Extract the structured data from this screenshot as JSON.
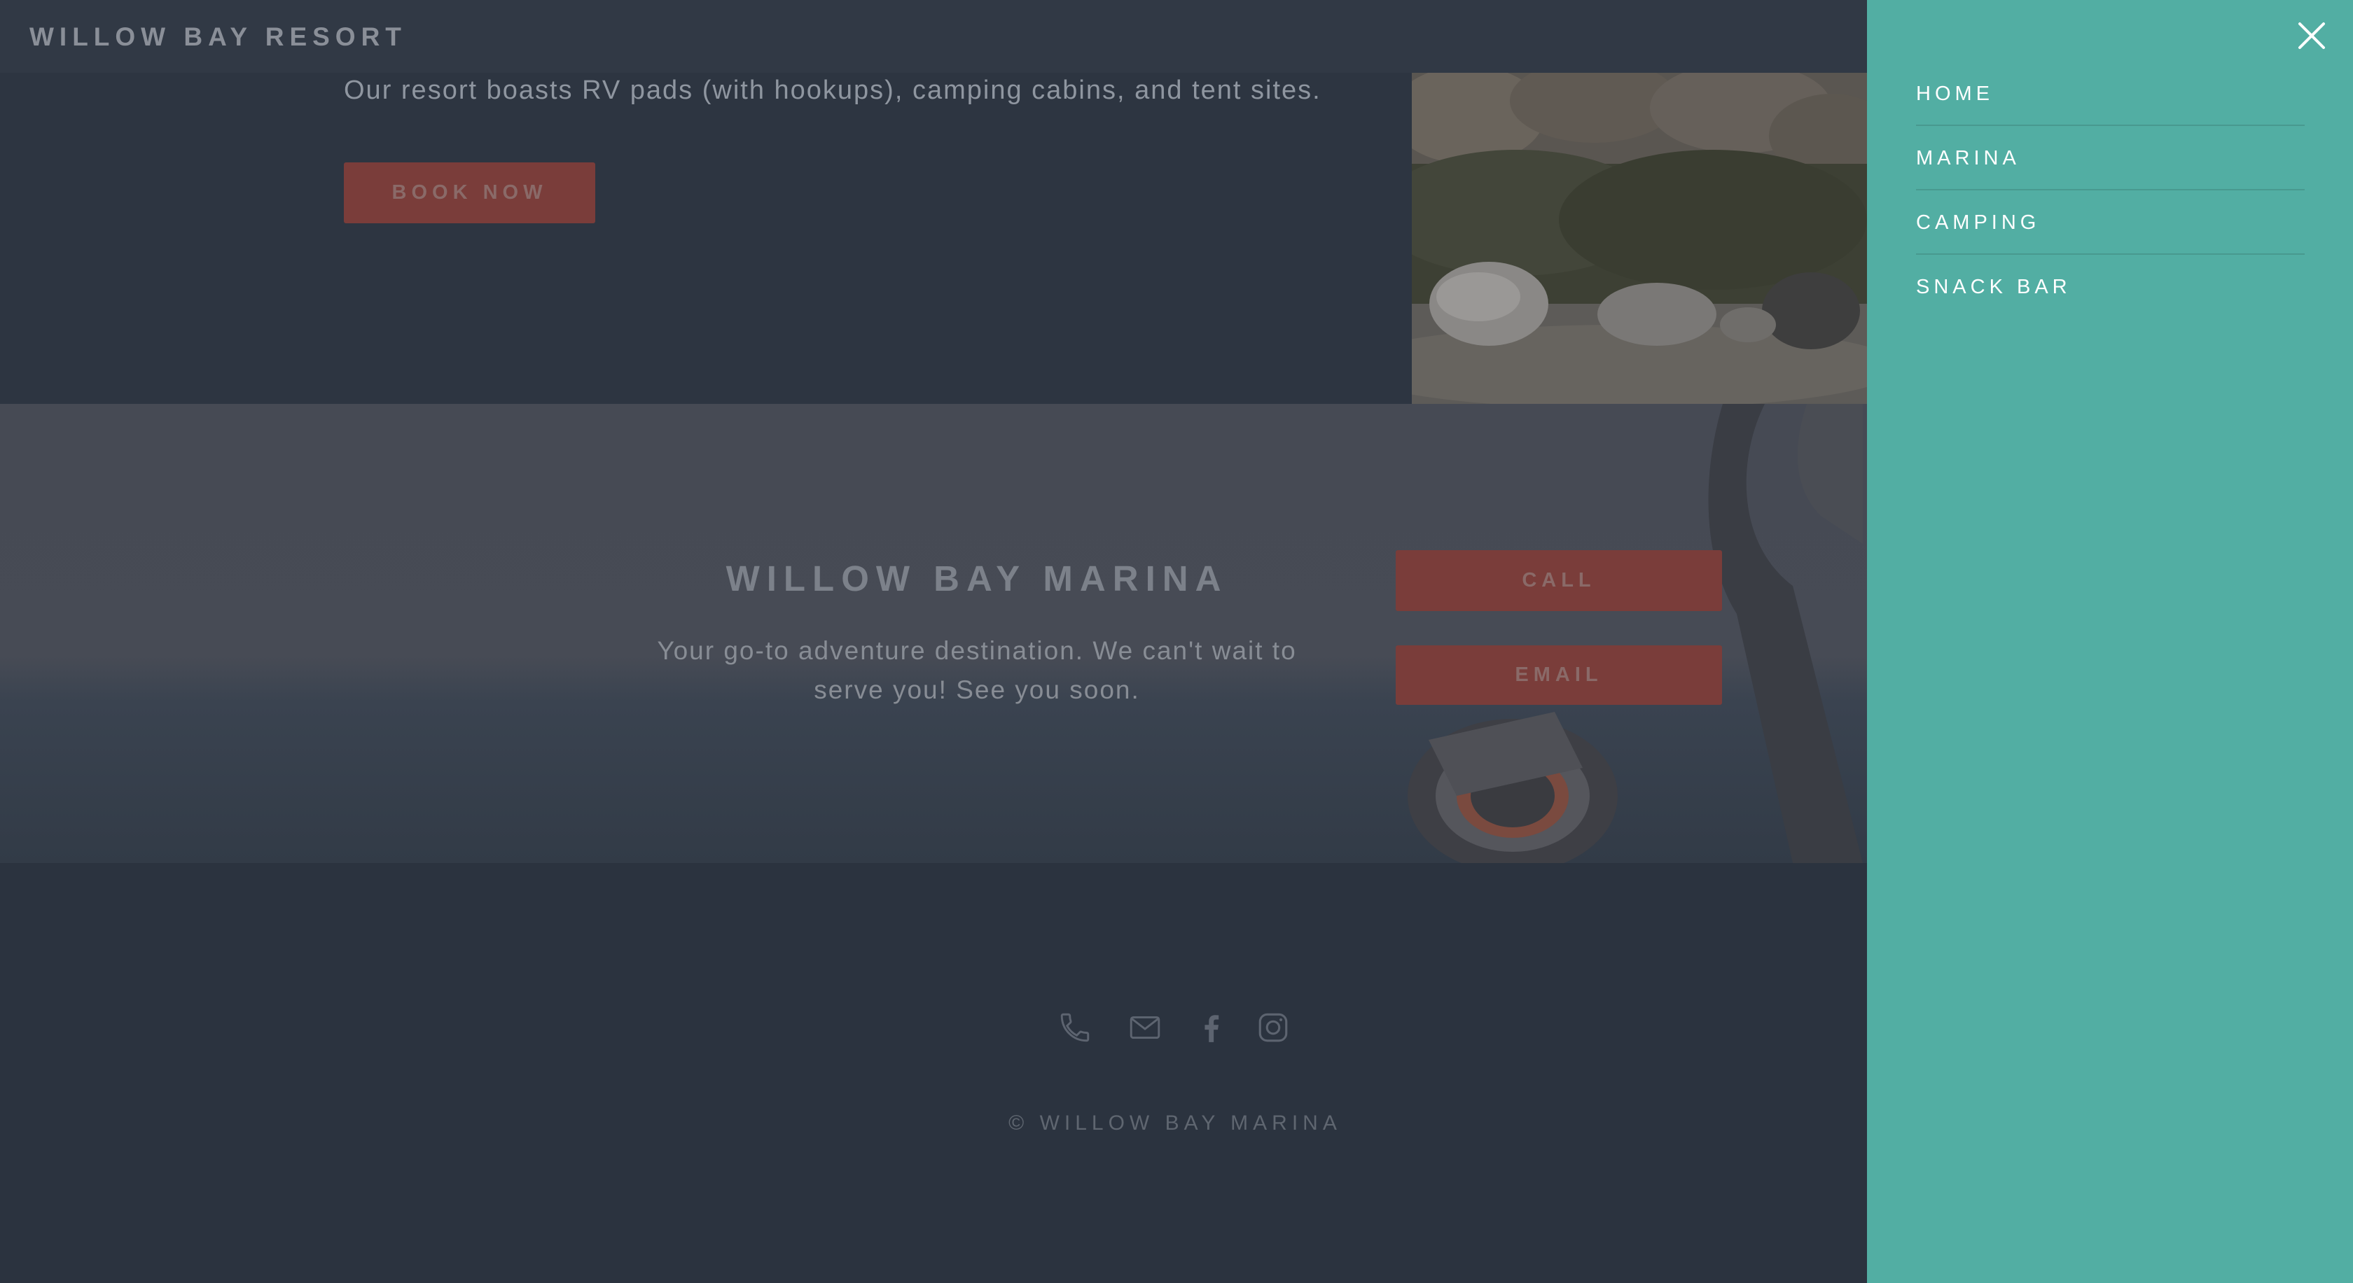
{
  "header": {
    "brand": "WILLOW BAY RESORT"
  },
  "camping": {
    "description": "Our resort boasts RV pads (with hookups), camping cabins, and tent sites.",
    "book_label": "BOOK NOW"
  },
  "marina": {
    "title": "WILLOW BAY MARINA",
    "subtitle_line1": "Your go-to adventure destination. We can't wait to",
    "subtitle_line2": "serve you! See you soon.",
    "call_label": "CALL",
    "email_label": "EMAIL"
  },
  "footer": {
    "icons": [
      "phone-icon",
      "envelope-icon",
      "facebook-icon",
      "instagram-icon"
    ],
    "copyright": "© WILLOW BAY MARINA"
  },
  "drawer": {
    "menu": [
      {
        "label": "HOME"
      },
      {
        "label": "MARINA"
      },
      {
        "label": "CAMPING"
      },
      {
        "label": "SNACK BAR"
      }
    ]
  },
  "colors": {
    "drawer_bg": "#52aea3",
    "button_red": "#7a3d3a",
    "page_bg": "#2c3440"
  }
}
